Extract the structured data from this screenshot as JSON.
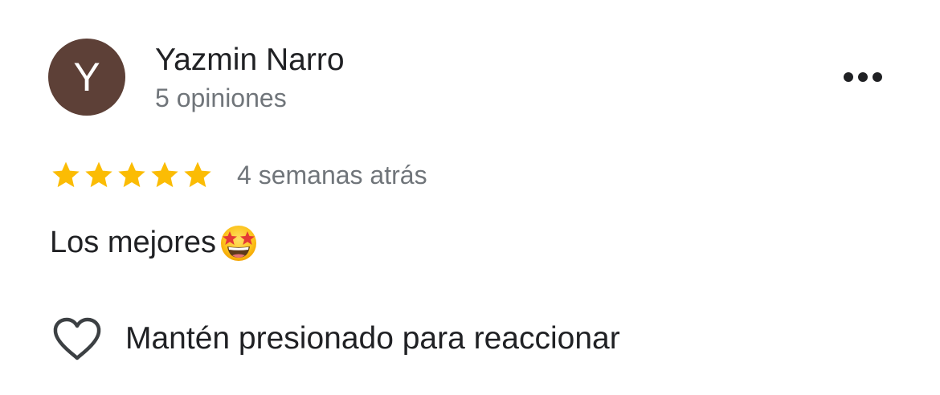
{
  "review": {
    "avatar_initial": "Y",
    "avatar_color": "#5d4037",
    "author_name": "Yazmin Narro",
    "review_count": "5 opiniones",
    "rating": 5,
    "rating_max": 5,
    "star_color": "#fbbc04",
    "date": "4 semanas atrás",
    "text": "Los mejores",
    "emoji": "star-struck-emoji"
  },
  "actions": {
    "more_icon": "more-horizontal-icon",
    "react_icon": "heart-outline-icon",
    "react_label": "Mantén presionado para reaccionar"
  }
}
